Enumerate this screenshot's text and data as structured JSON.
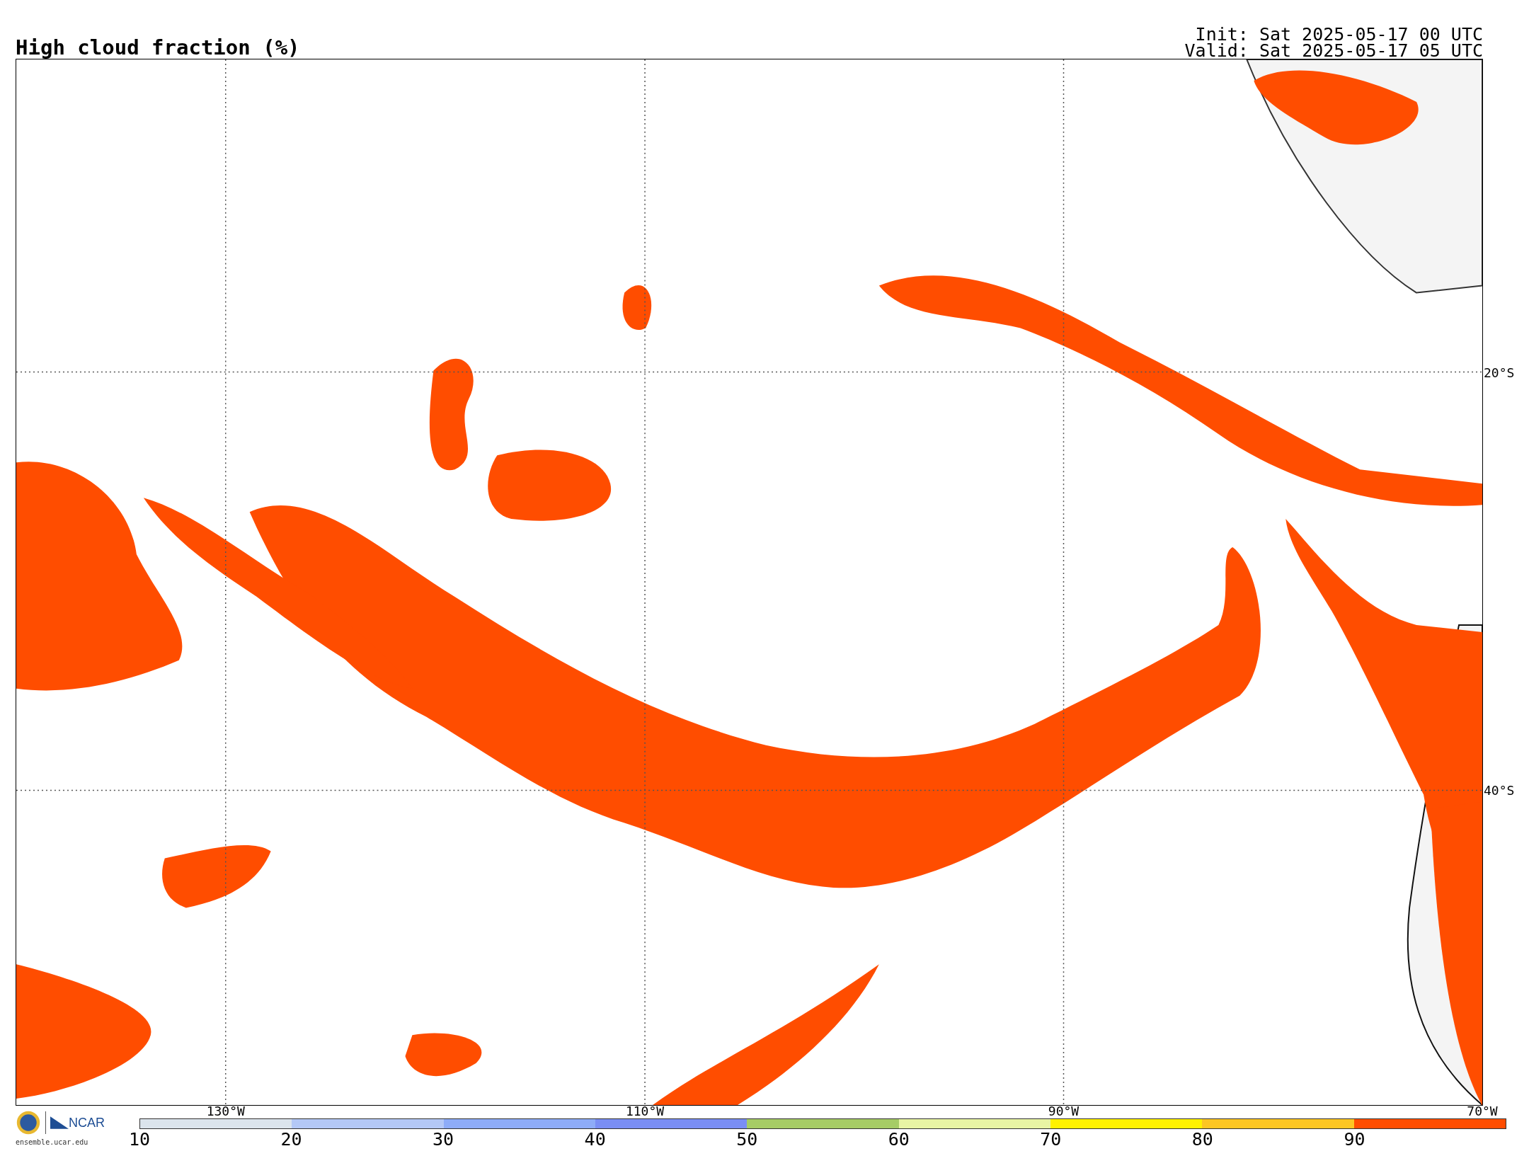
{
  "title": "High cloud fraction (%)",
  "init": "Init: Sat 2025-05-17 00 UTC",
  "valid": "Valid: Sat 2025-05-17 05 UTC",
  "map": {
    "lat_labels": [
      "20°S",
      "40°S"
    ],
    "lon_labels": [
      "130°W",
      "110°W",
      "90°W",
      "70°W"
    ]
  },
  "logo": {
    "org": "NCAR",
    "site": "ensemble.ucar.edu"
  },
  "colorbar": {
    "segments": [
      {
        "label": "10",
        "color": "#dbe4ec"
      },
      {
        "label": "20",
        "color": "#b4c8f6"
      },
      {
        "label": "30",
        "color": "#8eacf8"
      },
      {
        "label": "40",
        "color": "#7a8ef4"
      },
      {
        "label": "50",
        "color": "#a6cc66"
      },
      {
        "label": "60",
        "color": "#e8f5a4"
      },
      {
        "label": "70",
        "color": "#fff200"
      },
      {
        "label": "80",
        "color": "#fcc623"
      },
      {
        "label": "90",
        "color": "#ff4d00"
      }
    ]
  }
}
